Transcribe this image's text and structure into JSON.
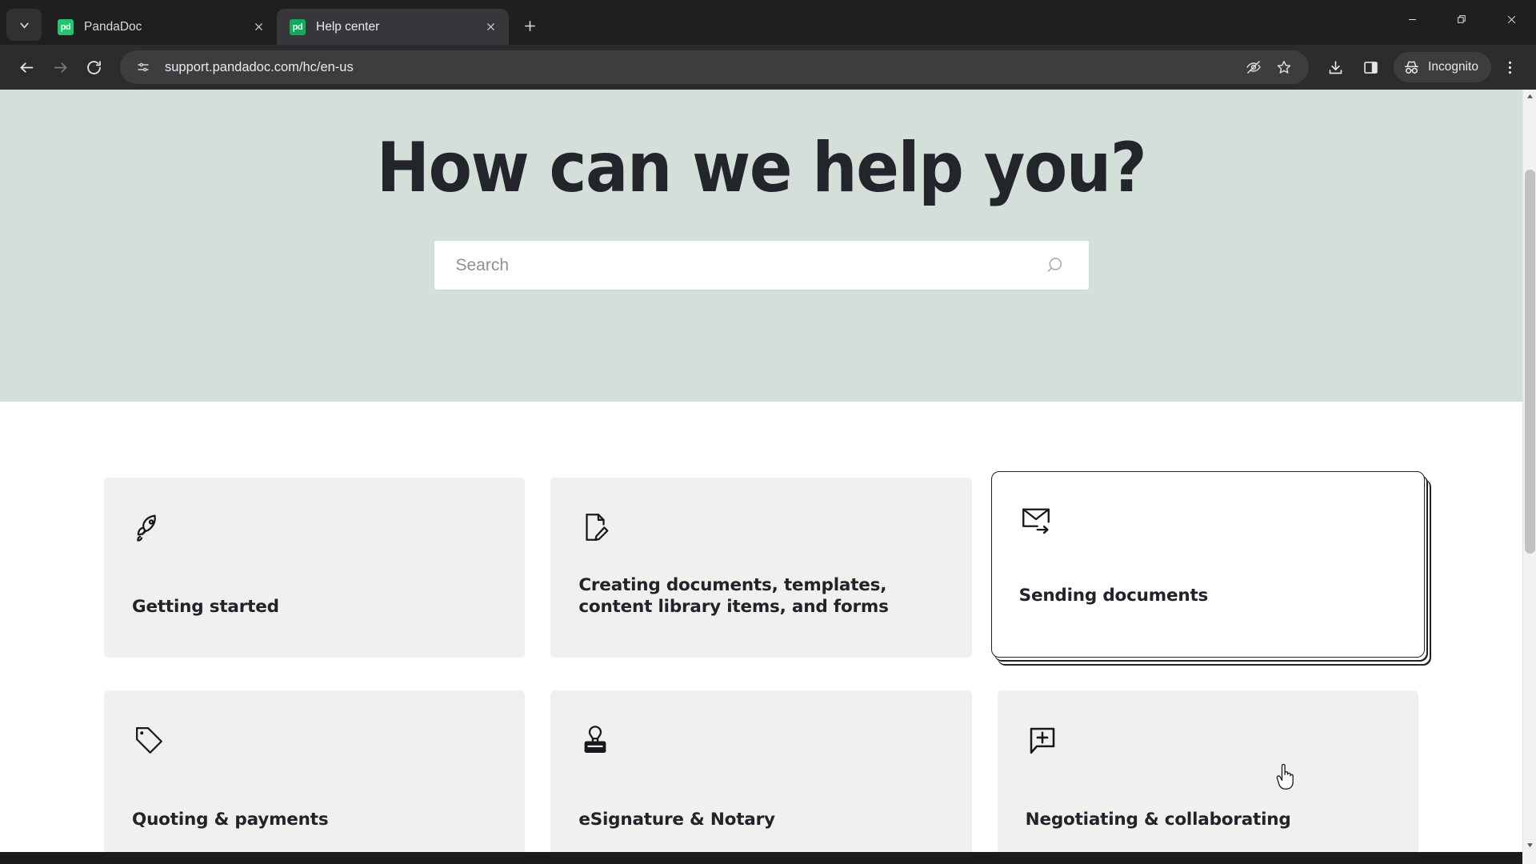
{
  "browser": {
    "tab_search_icon": "chevron-down-icon",
    "tabs": [
      {
        "title": "PandaDoc",
        "favicon_text": "pd",
        "active": false
      },
      {
        "title": "Help center",
        "favicon_text": "pd",
        "active": true
      }
    ],
    "new_tab_label": "+",
    "window_controls": [
      "minimize",
      "restore",
      "close"
    ],
    "toolbar": {
      "back_label": "Back",
      "forward_label": "Forward",
      "reload_label": "Reload",
      "site_info_label": "View site information",
      "url": "support.pandadoc.com/hc/en-us",
      "tracking_protection_label": "Tracking protection",
      "bookmark_label": "Bookmark this tab",
      "downloads_label": "Downloads",
      "side_panel_label": "Side panel",
      "incognito_label": "Incognito",
      "menu_label": "Customize and control Google Chrome"
    }
  },
  "hero": {
    "title": "How can we help you?",
    "background_color": "#d3dfd8"
  },
  "search": {
    "value": "",
    "placeholder": "Search",
    "submit_icon": "search-icon"
  },
  "categories": [
    {
      "title": "Getting started",
      "icon": "rocket-icon",
      "active": false
    },
    {
      "title": "Creating documents, templates, content library items, and forms",
      "icon": "document-edit-icon",
      "active": false
    },
    {
      "title": "Sending documents",
      "icon": "envelope-arrow-icon",
      "active": true
    },
    {
      "title": "Quoting & payments",
      "icon": "price-tag-icon",
      "active": false
    },
    {
      "title": "eSignature & Notary",
      "icon": "stamp-icon",
      "active": false
    },
    {
      "title": "Negotiating & collaborating",
      "icon": "comment-plus-icon",
      "active": false
    }
  ],
  "colors": {
    "hero_bg": "#d3dfd8",
    "card_bg": "#f2f0ee",
    "card_active_bg": "#ffffff",
    "card_active_border": "#1f2226",
    "text_dark": "#20242a",
    "brand_green": "#21c56f",
    "chrome_tabstrip": "#1f1f1f",
    "chrome_toolbar": "#2b2c2e"
  }
}
